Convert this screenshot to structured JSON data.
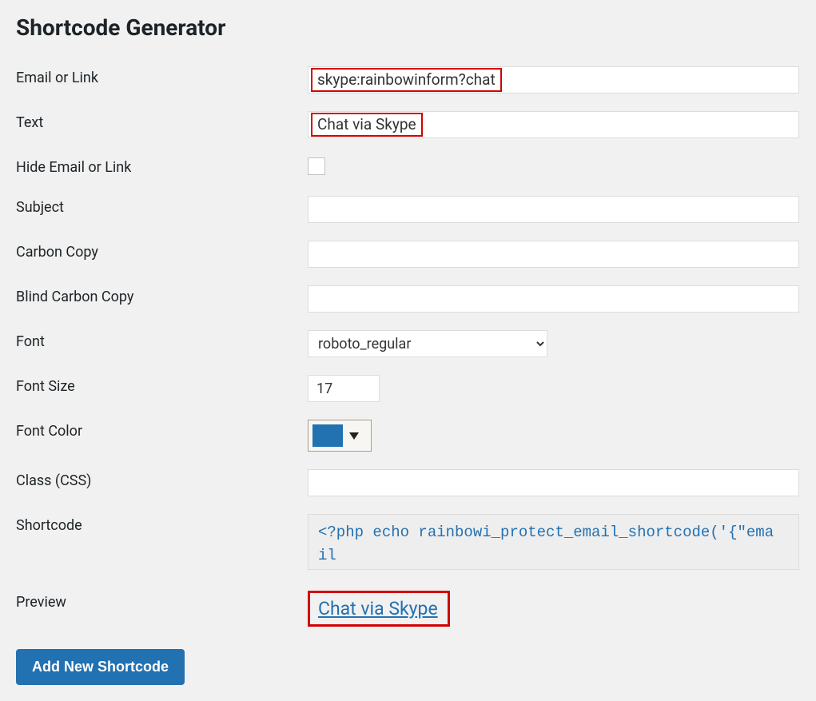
{
  "title": "Shortcode Generator",
  "fields": {
    "email_label": "Email or Link",
    "email_value": "skype:rainbowinform?chat",
    "text_label": "Text",
    "text_value": "Chat via Skype",
    "hide_label": "Hide Email or Link",
    "hide_checked": false,
    "subject_label": "Subject",
    "subject_value": "",
    "cc_label": "Carbon Copy",
    "cc_value": "",
    "bcc_label": "Blind Carbon Copy",
    "bcc_value": "",
    "font_label": "Font",
    "font_value": "roboto_regular",
    "fontsize_label": "Font Size",
    "fontsize_value": "17",
    "fontcolor_label": "Font Color",
    "fontcolor_value": "#2271b1",
    "class_label": "Class (CSS)",
    "class_value": "",
    "shortcode_label": "Shortcode",
    "shortcode_value": "<?php echo rainbowi_protect_email_shortcode('{\"email",
    "preview_label": "Preview",
    "preview_text": "Chat via Skype"
  },
  "button": {
    "add_label": "Add New Shortcode"
  }
}
